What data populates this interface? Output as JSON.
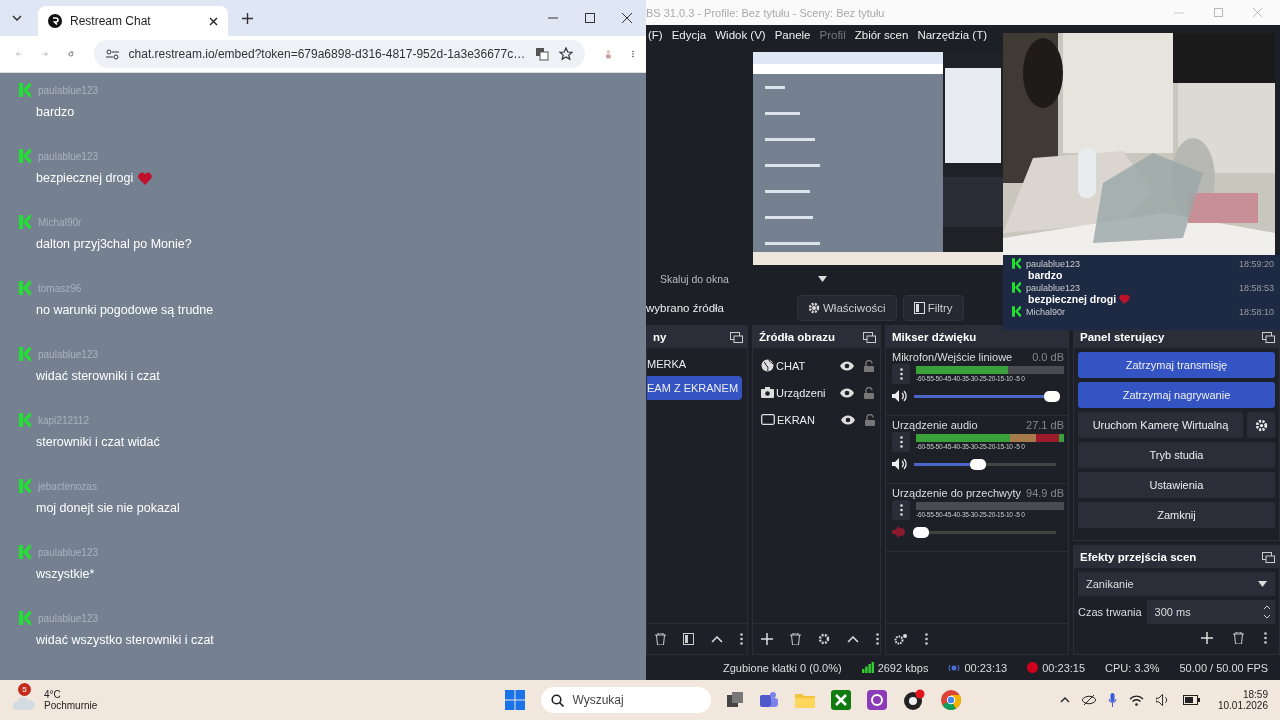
{
  "browser": {
    "tab": {
      "title": "Restream Chat"
    },
    "url": "chat.restream.io/embed?token=679a6898-d316-4817-952d-1a3e36677c…"
  },
  "chat": [
    {
      "user": "paulablue123",
      "message": "bardzo",
      "heart": false
    },
    {
      "user": "paulablue123",
      "message": "bezpiecznej drogi",
      "heart": true
    },
    {
      "user": "Michal90r",
      "message": "dalton przyj3chal po Monie?",
      "heart": false
    },
    {
      "user": "tomasz96",
      "message": "no warunki pogodowe są trudne",
      "heart": false
    },
    {
      "user": "paulablue123",
      "message": "widać sterowniki i czat",
      "heart": false
    },
    {
      "user": "kapi212112",
      "message": "sterowniki i czat widać",
      "heart": false
    },
    {
      "user": "jebactenozas",
      "message": "moj donejt sie nie pokazal",
      "heart": false
    },
    {
      "user": "paulablue123",
      "message": "wszystkie*",
      "heart": false
    },
    {
      "user": "paulablue123",
      "message": "widać wszystko sterowniki i czat",
      "heart": false
    }
  ],
  "obs": {
    "title": "BS 31.0.3 - Profile: Bez tytułu - Sceny: Bez tytułu",
    "menu": [
      {
        "label": "(F)",
        "disabled": false
      },
      {
        "label": "Edycja",
        "disabled": false
      },
      {
        "label": "Widok (V)",
        "disabled": false
      },
      {
        "label": "Panele",
        "disabled": false
      },
      {
        "label": "Profil",
        "disabled": true
      },
      {
        "label": "Zbiór scen",
        "disabled": false
      },
      {
        "label": "Narzędzia (T)",
        "disabled": false
      }
    ],
    "scale_mode": "Skaluj do okna",
    "overlay_chat": [
      {
        "user": "paulablue123",
        "time": "18:59:20",
        "message": "bardzo",
        "heart": false
      },
      {
        "user": "paulablue123",
        "time": "18:58:53",
        "message": "bezpiecznej drogi",
        "heart": true
      },
      {
        "user": "Michal90r",
        "time": "18:58:10"
      }
    ],
    "source_bar": {
      "status": "wybrano źródła",
      "buttons": [
        {
          "label": "Właściwości",
          "kind": "properties"
        },
        {
          "label": "Filtry",
          "kind": "filters"
        }
      ]
    },
    "scenes": {
      "title": "ny",
      "items": [
        {
          "label": "MERKA",
          "selected": false
        },
        {
          "label": "EAM Z EKRANEM",
          "selected": true
        }
      ]
    },
    "sources": {
      "title": "Źródła obrazu",
      "items": [
        {
          "label": "CHAT",
          "kind": "browser",
          "visible": true
        },
        {
          "label": "Urządzeni",
          "kind": "camera",
          "visible": true
        },
        {
          "label": "EKRAN",
          "kind": "display",
          "visible": true
        }
      ]
    },
    "mixer": {
      "title": "Mikser dźwięku",
      "channels": [
        {
          "name": "Mikrofon/Wejście liniowe",
          "reading": "0.0 dB",
          "scale": "-60-55-50-45-40-35-30-25-20-15-10 -5 0",
          "meter": {
            "level": 0.62
          },
          "volume": {
            "level": 0.97
          },
          "muted": false
        },
        {
          "name": "Urządzenie audio",
          "reading": "27.1 dB",
          "scale": "-60-55-50-45-40-35-30-25-20-15-10 -5 0",
          "meter": {
            "level": 1
          },
          "volume": {
            "level": 0.45
          },
          "muted": false
        },
        {
          "name": "Urządzenie do przechwyty",
          "reading": "94.9 dB",
          "scale": "-60-55-50-45-40-35-30-25-20-15-10 -5 0",
          "meter": {
            "level": 0
          },
          "volume": {
            "level": 0.05
          },
          "muted": true
        }
      ]
    },
    "controls": {
      "title": "Panel sterujący",
      "buttons": [
        {
          "label": "Zatrzymaj transmisję",
          "active": true
        },
        {
          "label": "Zatrzymaj nagrywanie",
          "active": true
        },
        {
          "label": "Uruchom Kamerę Wirtualną",
          "active": false
        },
        {
          "label": "Tryb studia",
          "active": false
        },
        {
          "label": "Ustawienia",
          "active": false
        },
        {
          "label": "Zamknij",
          "active": false
        }
      ]
    },
    "transitions": {
      "title": "Efekty przejścia scen",
      "effect": "Zanikanie",
      "duration_label": "Czas trwania",
      "duration": "300 ms"
    },
    "status": {
      "dropped": "Zgubione klatki 0 (0.0%)",
      "bitrate": "2692 kbps",
      "stream_time": "00:23:13",
      "record_time": "00:23:15",
      "cpu": "CPU: 3.3%",
      "fps": "50.00 / 50.00 FPS"
    }
  },
  "taskbar": {
    "weather": {
      "badge": "5",
      "temp": "4°C",
      "condition": "Pochmurnie"
    },
    "search": {
      "placeholder": "Wyszukaj"
    },
    "time": "18:59",
    "date": "10.01.2026"
  }
}
